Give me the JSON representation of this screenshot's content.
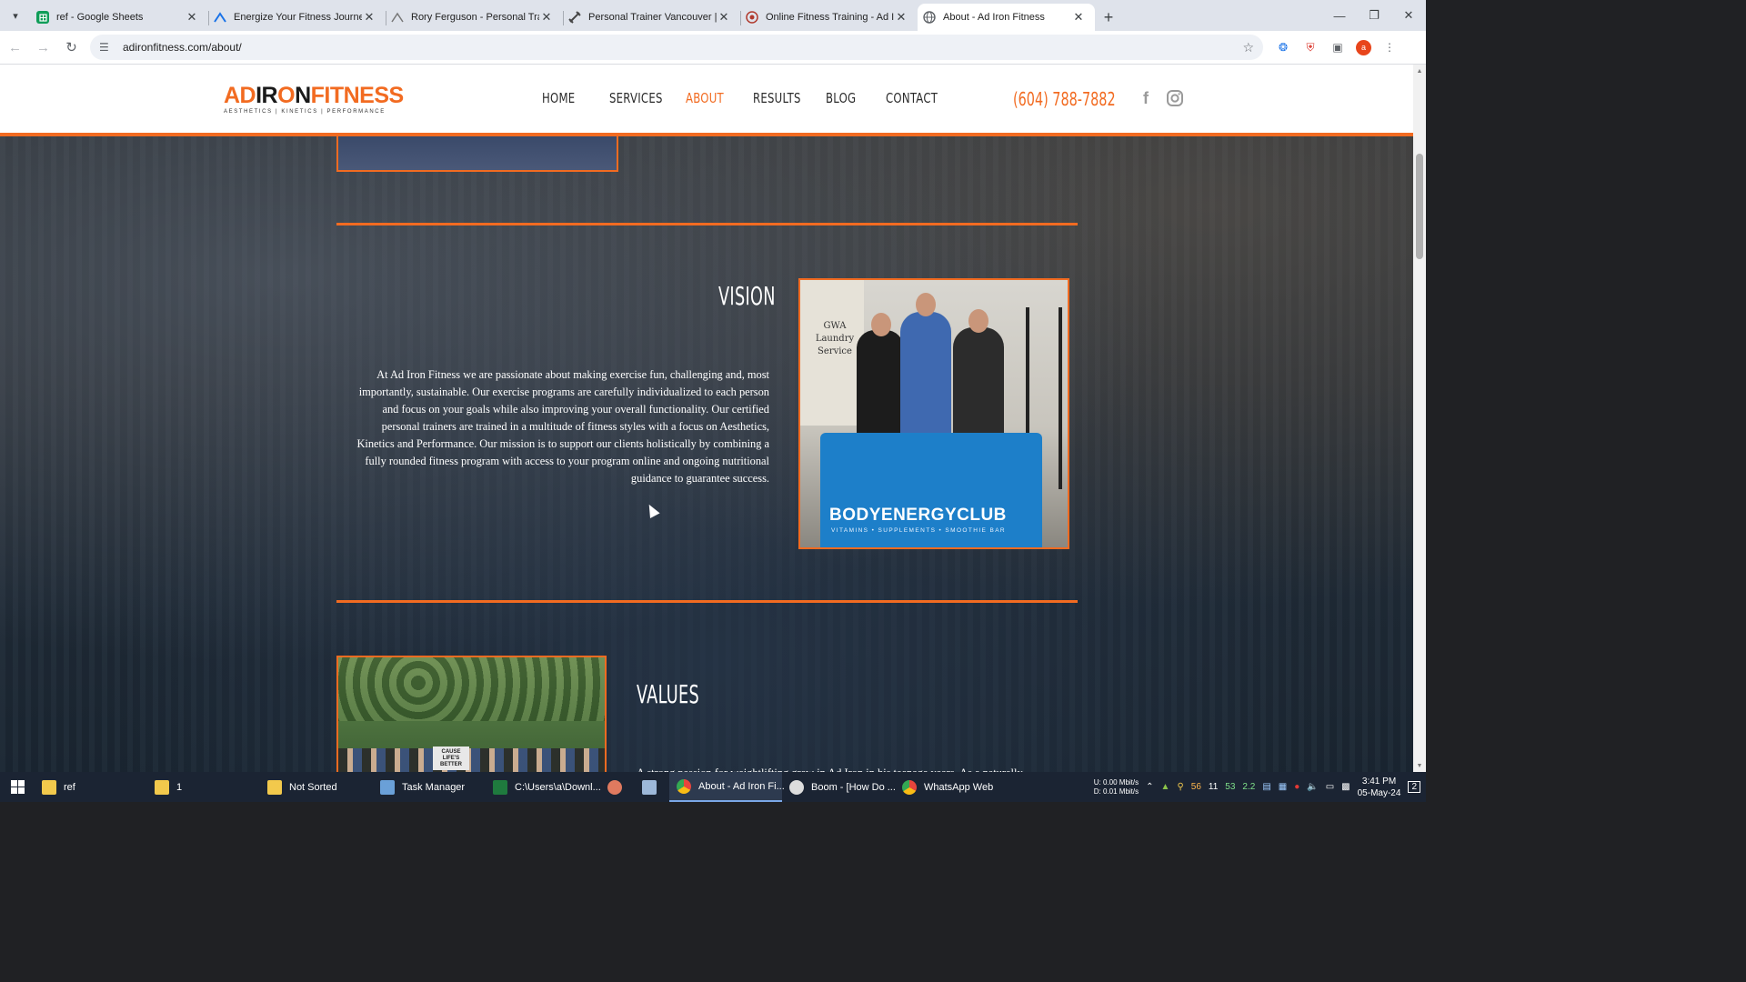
{
  "browser": {
    "tabs": [
      {
        "title": "ref - Google Sheets",
        "favicon": "sheets-icon",
        "color": "#0f9d58",
        "active": false
      },
      {
        "title": "Energize Your Fitness Journey w",
        "favicon": "mountain-logo-icon",
        "color": "#1a73e8",
        "active": false
      },
      {
        "title": "Rory Ferguson - Personal Traini",
        "favicon": "mountain-logo-icon",
        "color": "#777777",
        "active": false
      },
      {
        "title": "Personal Trainer Vancouver | We",
        "favicon": "dumbbell-icon",
        "color": "#444444",
        "active": false
      },
      {
        "title": "Online Fitness Training - Ad Iro",
        "favicon": "globe-icon",
        "color": "#b03a2e",
        "active": false
      },
      {
        "title": "About - Ad Iron Fitness",
        "favicon": "globe-icon",
        "color": "#5f6368",
        "active": true
      }
    ],
    "url": "adironfitness.com/about/"
  },
  "site": {
    "logo": {
      "part1": "AD",
      "part2": "IR",
      "part3": "O",
      "part4": "N",
      "part5": "FITNESS",
      "tagline": "AESTHETICS | KINETICS | PERFORMANCE"
    },
    "nav": [
      "HOME",
      "SERVICES",
      "ABOUT",
      "RESULTS",
      "BLOG",
      "CONTACT"
    ],
    "nav_current": "ABOUT",
    "phone": "(604) 788-7882",
    "accent_color": "#f26b21"
  },
  "vision": {
    "heading": "VISION",
    "body": "At Ad Iron Fitness we are passionate about making exercise fun, challenging and, most importantly, sustainable. Our exercise programs are carefully individualized to each person and focus on your goals while also improving your overall functionality. Our certified personal trainers are trained in a multitude of fitness styles with a focus on Aesthetics, Kinetics and Performance. Our mission is to support our clients holistically by combining a fully rounded fitness program with access to your program online and ongoing nutritional guidance to guarantee success.",
    "photo_sign": "GWA Laundry Service",
    "photo_brand": "BODYENERGYCLUB",
    "photo_brand_sub": "VITAMINS • SUPPLEMENTS • SMOOTHIE BAR"
  },
  "values": {
    "heading": "VALUES",
    "photo_placard": "CAUSE LIFE'S BETTER",
    "body_partial": "A strong passion for weightlifting grew in Ad Iron in his teenage years. As a naturally"
  },
  "taskbar": {
    "items": [
      {
        "label": "ref",
        "icon": "folder-icon",
        "color": "#f2c94c"
      },
      {
        "label": "1",
        "icon": "folder-icon",
        "color": "#f2c94c"
      },
      {
        "label": "Not Sorted",
        "icon": "folder-icon",
        "color": "#f2c94c"
      },
      {
        "label": "Task Manager",
        "icon": "task-manager-icon",
        "color": "#6aa0d8"
      },
      {
        "label": "C:\\Users\\a\\Downl...",
        "icon": "excel-icon",
        "color": "#1f7a3e"
      },
      {
        "label": "",
        "icon": "app-icon",
        "color": "#e07a5f"
      },
      {
        "label": "",
        "icon": "notepad-icon",
        "color": "#9db8d9"
      },
      {
        "label": "About - Ad Iron Fi...",
        "icon": "chrome-icon",
        "color": "#e8453c",
        "active": true
      },
      {
        "label": "Boom - [How Do ...",
        "icon": "boom-icon",
        "color": "#dddddd"
      },
      {
        "label": "WhatsApp Web",
        "icon": "chrome-icon",
        "color": "#e8453c"
      }
    ],
    "net_up": "0.00 Mbit/s",
    "net_down": "0.01 Mbit/s",
    "net_up_label": "U:",
    "net_down_label": "D:",
    "tray_nums": [
      "56",
      "11",
      "53",
      "2.2"
    ],
    "time": "3:41 PM",
    "date": "05-May-24",
    "notification_count": "2"
  }
}
